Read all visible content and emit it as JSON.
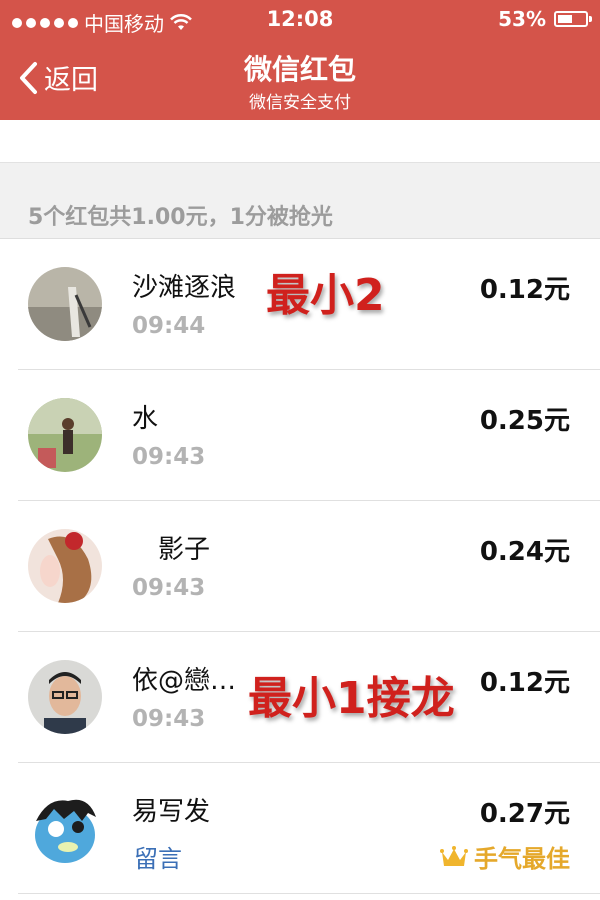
{
  "status_bar": {
    "carrier": "中国移动",
    "time": "12:08",
    "battery": "53%",
    "battery_level": 0.53
  },
  "nav": {
    "back_label": "返回",
    "title": "微信红包",
    "subtitle": "微信安全支付"
  },
  "summary": "5个红包共1.00元，1分被抢光",
  "entries": [
    {
      "name": "沙滩逐浪",
      "time": "09:44",
      "amount": "0.12元",
      "annotation": "最小2"
    },
    {
      "name": "水",
      "time": "09:43",
      "amount": "0.25元"
    },
    {
      "name": "　影子",
      "time": "09:43",
      "amount": "0.24元"
    },
    {
      "name": "依@戀…",
      "time": "09:43",
      "amount": "0.12元",
      "annotation": "最小1接龙"
    },
    {
      "name": "易写发",
      "note_link": "留言",
      "amount": "0.27元",
      "best_badge": "手气最佳"
    }
  ],
  "colors": {
    "nav_bg": "#d4544a",
    "accent_gold": "#e5a82b",
    "link_blue": "#3b6fb6",
    "annotation_red": "#d0211d"
  }
}
